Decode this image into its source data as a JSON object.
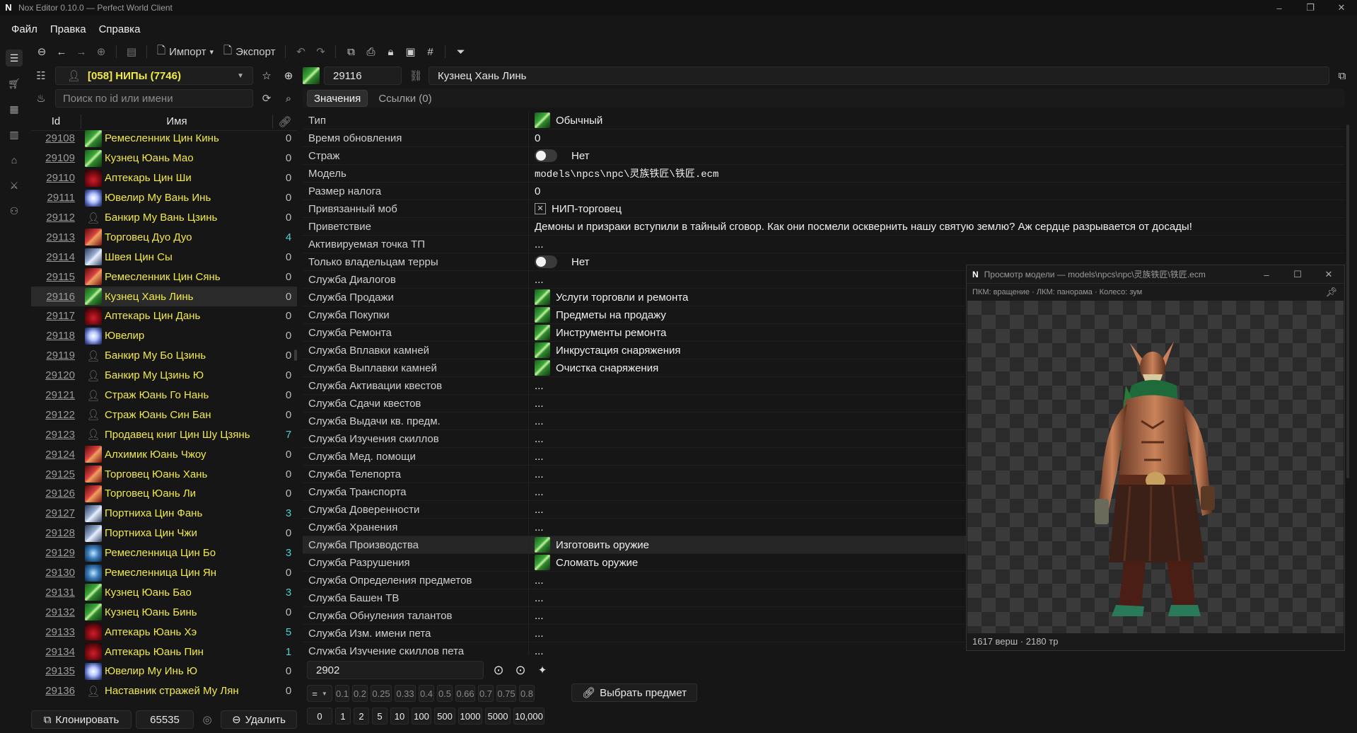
{
  "window": {
    "title": "Nox Editor 0.10.0 — Perfect World Client"
  },
  "menu": [
    "Файл",
    "Правка",
    "Справка"
  ],
  "toolbar": {
    "import_label": "Импорт",
    "export_label": "Экспорт"
  },
  "category": {
    "label": "[058] НИПы (7746)"
  },
  "record": {
    "id": "29116",
    "name": "Кузнец Хань Линь"
  },
  "search": {
    "placeholder": "Поиск по id или имени"
  },
  "tabs": [
    "Значения",
    "Ссылки (0)"
  ],
  "list_headers": {
    "id": "Id",
    "name": "Имя"
  },
  "list": [
    {
      "id": "29108",
      "name": "Ремесленник Цин Кинь",
      "count": "0",
      "icon": "sword"
    },
    {
      "id": "29109",
      "name": "Кузнец Юань Мао",
      "count": "0",
      "icon": "sword"
    },
    {
      "id": "29110",
      "name": "Аптекарь Цин Ши",
      "count": "0",
      "icon": "potion"
    },
    {
      "id": "29111",
      "name": "Ювелир Му Вань Инь",
      "count": "0",
      "icon": "jewel"
    },
    {
      "id": "29112",
      "name": "Банкир Му Вань Цзинь",
      "count": "0",
      "icon": "person"
    },
    {
      "id": "29113",
      "name": "Торговец Дуо Дуо",
      "count": "4",
      "icon": "fish"
    },
    {
      "id": "29114",
      "name": "Швея Цин Сы",
      "count": "0",
      "icon": "cloth"
    },
    {
      "id": "29115",
      "name": "Ремесленник Цин Сянь",
      "count": "0",
      "icon": "fish"
    },
    {
      "id": "29116",
      "name": "Кузнец Хань Линь",
      "count": "0",
      "icon": "sword"
    },
    {
      "id": "29117",
      "name": "Аптекарь Цин Дань",
      "count": "0",
      "icon": "potion"
    },
    {
      "id": "29118",
      "name": "Ювелир",
      "count": "0",
      "icon": "jewel"
    },
    {
      "id": "29119",
      "name": "Банкир Му Бо Цзинь",
      "count": "0",
      "icon": "person"
    },
    {
      "id": "29120",
      "name": "Банкир Му Цзинь Ю",
      "count": "0",
      "icon": "person"
    },
    {
      "id": "29121",
      "name": "Страж Юань Го Нань",
      "count": "0",
      "icon": "person"
    },
    {
      "id": "29122",
      "name": "Страж Юань Син Бан",
      "count": "0",
      "icon": "person"
    },
    {
      "id": "29123",
      "name": "Продавец книг Цин Шу Цзянь",
      "count": "7",
      "icon": "person"
    },
    {
      "id": "29124",
      "name": "Алхимик Юань Чжоу",
      "count": "0",
      "icon": "fish"
    },
    {
      "id": "29125",
      "name": "Торговец Юань Хань",
      "count": "0",
      "icon": "fish"
    },
    {
      "id": "29126",
      "name": "Торговец Юань Ли",
      "count": "0",
      "icon": "fish"
    },
    {
      "id": "29127",
      "name": "Портниха Цин Фань",
      "count": "3",
      "icon": "cloth"
    },
    {
      "id": "29128",
      "name": "Портниха Цин Чжи",
      "count": "0",
      "icon": "cloth"
    },
    {
      "id": "29129",
      "name": "Ремесленница Цин Бо",
      "count": "3",
      "icon": "swirl"
    },
    {
      "id": "29130",
      "name": "Ремесленница Цин Ян",
      "count": "0",
      "icon": "swirl"
    },
    {
      "id": "29131",
      "name": "Кузнец Юань Бао",
      "count": "3",
      "icon": "sword"
    },
    {
      "id": "29132",
      "name": "Кузнец Юань Бинь",
      "count": "0",
      "icon": "sword"
    },
    {
      "id": "29133",
      "name": "Аптекарь Юань Хэ",
      "count": "5",
      "icon": "potion"
    },
    {
      "id": "29134",
      "name": "Аптекарь Юань Пин",
      "count": "1",
      "icon": "potion"
    },
    {
      "id": "29135",
      "name": "Ювелир Му Инь Ю",
      "count": "0",
      "icon": "jewel"
    },
    {
      "id": "29136",
      "name": "Наставник стражей Му Лян",
      "count": "0",
      "icon": "person"
    }
  ],
  "props": [
    {
      "label": "Тип",
      "type": "icon",
      "value": "Обычный"
    },
    {
      "label": "Время обновления",
      "type": "text",
      "value": "0"
    },
    {
      "label": "Страж",
      "type": "toggle",
      "value": "Нет"
    },
    {
      "label": "Модель",
      "type": "mono",
      "value": "models\\npcs\\npc\\灵族铁匠\\铁匠.ecm"
    },
    {
      "label": "Размер налога",
      "type": "text",
      "value": "0"
    },
    {
      "label": "Привязанный моб",
      "type": "x",
      "value": "НИП-торговец"
    },
    {
      "label": "Приветствие",
      "type": "text",
      "value": "Демоны и призраки вступили в тайный сговор. Как они посмели осквернить нашу святую землю? Аж сердце разрывается от досады!"
    },
    {
      "label": "Активируемая точка ТП",
      "type": "text",
      "value": "..."
    },
    {
      "label": "Только владельцам терры",
      "type": "toggle",
      "value": "Нет"
    },
    {
      "label": "Служба Диалогов",
      "type": "text",
      "value": "..."
    },
    {
      "label": "Служба Продажи",
      "type": "icon",
      "value": "Услуги торговли и ремонта"
    },
    {
      "label": "Служба Покупки",
      "type": "icon",
      "value": "Предметы на продажу"
    },
    {
      "label": "Служба Ремонта",
      "type": "icon",
      "value": "Инструменты ремонта"
    },
    {
      "label": "Служба Вплавки камней",
      "type": "icon",
      "value": "Инкрустация снаряжения"
    },
    {
      "label": "Служба Выплавки камней",
      "type": "icon",
      "value": "Очистка снаряжения"
    },
    {
      "label": "Служба Активации квестов",
      "type": "text",
      "value": "..."
    },
    {
      "label": "Служба Сдачи квестов",
      "type": "text",
      "value": "..."
    },
    {
      "label": "Служба Выдачи кв. предм.",
      "type": "text",
      "value": "..."
    },
    {
      "label": "Служба Изучения скиллов",
      "type": "text",
      "value": "..."
    },
    {
      "label": "Служба Мед. помощи",
      "type": "text",
      "value": "..."
    },
    {
      "label": "Служба Телепорта",
      "type": "text",
      "value": "..."
    },
    {
      "label": "Служба Транспорта",
      "type": "text",
      "value": "..."
    },
    {
      "label": "Служба Доверенности",
      "type": "text",
      "value": "..."
    },
    {
      "label": "Служба Хранения",
      "type": "text",
      "value": "..."
    },
    {
      "label": "Служба Производства",
      "type": "icon",
      "value": "Изготовить оружие"
    },
    {
      "label": "Служба Разрушения",
      "type": "icon",
      "value": "Сломать оружие"
    },
    {
      "label": "Служба Определения предметов",
      "type": "text",
      "value": "..."
    },
    {
      "label": "Служба Башен ТВ",
      "type": "text",
      "value": "..."
    },
    {
      "label": "Служба Обнуления талантов",
      "type": "text",
      "value": "..."
    },
    {
      "label": "Служба Изм. имени пета",
      "type": "text",
      "value": "..."
    },
    {
      "label": "Служба Изучение скиллов пета",
      "type": "text",
      "value": "..."
    }
  ],
  "viewer": {
    "title": "Просмотр модели — models\\npcs\\npc\\灵族铁匠\\铁匠.ecm",
    "hint": "ПКМ: вращение · ЛКМ: панорама · Колесо: зум",
    "stats": "1617 верш · 2180 тр"
  },
  "editor": {
    "value": "2902",
    "op": "=",
    "multipliers": [
      "0.1",
      "0.2",
      "0.25",
      "0.33",
      "0.4",
      "0.5",
      "0.66",
      "0.7",
      "0.75",
      "0.8"
    ],
    "numbers": [
      "0",
      "1",
      "2",
      "5",
      "10",
      "100",
      "500",
      "1000",
      "5000",
      "10,000"
    ],
    "pick_label": "Выбрать предмет"
  },
  "bottombar": {
    "clone_label": "Клонировать",
    "next_id": "65535",
    "delete_label": "Удалить"
  }
}
